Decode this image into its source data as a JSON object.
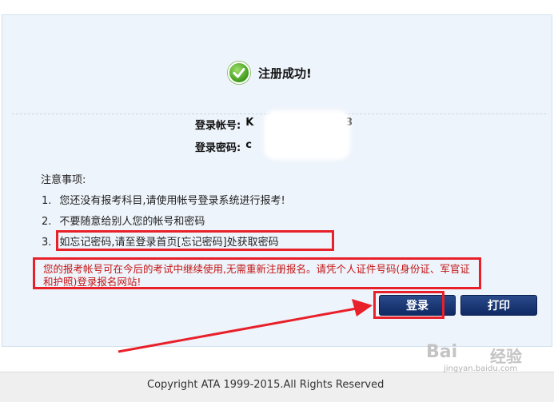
{
  "success": {
    "message": "注册成功!"
  },
  "credentials": {
    "account_label": "登录帐号:",
    "account_value": "K",
    "account_tail": "3",
    "password_label": "登录密码:",
    "password_value": "c"
  },
  "notes": {
    "title": "注意事项:",
    "items": [
      {
        "num": "1.",
        "text": "您还没有报考科目,请使用帐号登录系统进行报考!"
      },
      {
        "num": "2.",
        "text": "不要随意给别人您的帐号和密码"
      },
      {
        "num": "3.",
        "text": "如忘记密码,请至登录首页[忘记密码]处获取密码"
      }
    ],
    "warning": "您的报考帐号可在今后的考试中继续使用,无需重新注册报名。请凭个人证件号码(身份证、军官证和护照)登录报名网站!"
  },
  "buttons": {
    "login": "登录",
    "print": "打印"
  },
  "footer": {
    "copyright": "Copyright ATA 1999-2015.All Rights Reserved"
  },
  "watermark": {
    "logo": "Bai",
    "text": "经验",
    "url": "jingyan.baidu.com"
  },
  "colors": {
    "annotation_red": "#e8202a",
    "button_navy": "#1a3574",
    "warning_text": "#c31414",
    "panel_bg": "#eef4fb"
  }
}
